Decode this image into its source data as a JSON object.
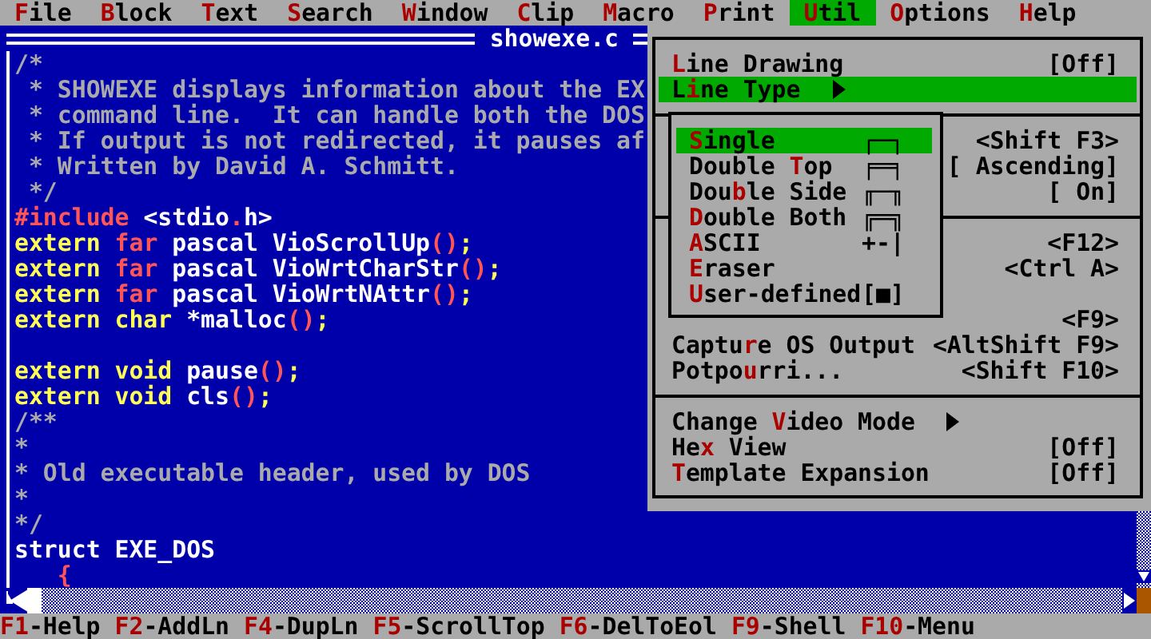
{
  "menu_bar": [
    {
      "label": "**F**ile",
      "selected": false
    },
    {
      "label": "**B**lock",
      "selected": false
    },
    {
      "label": "**T**ext",
      "selected": false
    },
    {
      "label": "**S**earch",
      "selected": false
    },
    {
      "label": "**W**indow",
      "selected": false
    },
    {
      "label": "**C**lip",
      "selected": false
    },
    {
      "label": "**M**acro",
      "selected": false
    },
    {
      "label": "**P**rint",
      "selected": false
    },
    {
      "label": "**U**til",
      "selected": true
    },
    {
      "label": "**O**ptions",
      "selected": false
    },
    {
      "label": "**H**elp",
      "selected": false
    }
  ],
  "editor": {
    "title": "showexe.c",
    "lines": [
      {
        "tokens": [
          {
            "text": "/*",
            "kind": "comment"
          }
        ]
      },
      {
        "tokens": [
          {
            "text": " * SHOWEXE displays information about the EX",
            "kind": "comment"
          }
        ]
      },
      {
        "tokens": [
          {
            "text": " * command line.  It can handle both the DOS",
            "kind": "comment"
          }
        ]
      },
      {
        "tokens": [
          {
            "text": " * If output is not redirected, it pauses af",
            "kind": "comment"
          }
        ]
      },
      {
        "tokens": [
          {
            "text": " * Written by David A. Schmitt.",
            "kind": "comment"
          }
        ]
      },
      {
        "tokens": [
          {
            "text": " */",
            "kind": "comment"
          }
        ]
      },
      {
        "tokens": [
          {
            "text": "#include",
            "kind": "accent"
          },
          {
            "text": " <stdio",
            "kind": "text"
          },
          {
            "text": ".",
            "kind": "accent"
          },
          {
            "text": "h>",
            "kind": "text"
          }
        ]
      },
      {
        "tokens": [
          {
            "text": "extern ",
            "kind": "keyword"
          },
          {
            "text": "far ",
            "kind": "accent"
          },
          {
            "text": "pascal VioScrollUp",
            "kind": "text"
          },
          {
            "text": "()",
            "kind": "accent"
          },
          {
            "text": ";",
            "kind": "keyword"
          }
        ]
      },
      {
        "tokens": [
          {
            "text": "extern ",
            "kind": "keyword"
          },
          {
            "text": "far ",
            "kind": "accent"
          },
          {
            "text": "pascal VioWrtCharStr",
            "kind": "text"
          },
          {
            "text": "()",
            "kind": "accent"
          },
          {
            "text": ";",
            "kind": "keyword"
          }
        ]
      },
      {
        "tokens": [
          {
            "text": "extern ",
            "kind": "keyword"
          },
          {
            "text": "far ",
            "kind": "accent"
          },
          {
            "text": "pascal VioWrtNAttr",
            "kind": "text"
          },
          {
            "text": "()",
            "kind": "accent"
          },
          {
            "text": ";",
            "kind": "keyword"
          }
        ]
      },
      {
        "tokens": [
          {
            "text": "extern char ",
            "kind": "keyword"
          },
          {
            "text": "*malloc",
            "kind": "text"
          },
          {
            "text": "()",
            "kind": "accent"
          },
          {
            "text": ";",
            "kind": "keyword"
          }
        ]
      },
      {
        "blank_line_before": true,
        "tokens": [
          {
            "text": "extern void ",
            "kind": "keyword"
          },
          {
            "text": "pause",
            "kind": "text"
          },
          {
            "text": "()",
            "kind": "accent"
          },
          {
            "text": ";",
            "kind": "keyword"
          }
        ]
      },
      {
        "tokens": [
          {
            "text": "extern void ",
            "kind": "keyword"
          },
          {
            "text": "cls",
            "kind": "text"
          },
          {
            "text": "()",
            "kind": "accent"
          },
          {
            "text": ";",
            "kind": "keyword"
          }
        ]
      },
      {
        "tokens": [
          {
            "text": "/**",
            "kind": "comment"
          }
        ]
      },
      {
        "tokens": [
          {
            "text": "*",
            "kind": "comment"
          }
        ]
      },
      {
        "tokens": [
          {
            "text": "* Old executable header, used by DOS",
            "kind": "comment"
          }
        ]
      },
      {
        "tokens": [
          {
            "text": "*",
            "kind": "comment"
          }
        ]
      },
      {
        "tokens": [
          {
            "text": "*/",
            "kind": "comment"
          }
        ]
      },
      {
        "tokens": [
          {
            "text": "struct EXE_DOS",
            "kind": "text"
          }
        ]
      },
      {
        "tokens": [
          {
            "text": "   {",
            "kind": "accent"
          }
        ]
      }
    ]
  },
  "util_menu": {
    "items": [
      {
        "kind": "item",
        "label": "**L**ine Drawing",
        "shortcut": "[Off]",
        "submenu": false,
        "selected": false
      },
      {
        "kind": "item",
        "label": "L**i**ne Type",
        "submenu": true,
        "selected": true
      },
      {
        "kind": "separator"
      },
      {
        "kind": "item",
        "shortcut": "<Shift F3>",
        "selected": false
      },
      {
        "kind": "item",
        "shortcut": "[ Ascending]",
        "selected": false
      },
      {
        "kind": "item",
        "shortcut": "[ On]",
        "selected": false
      },
      {
        "kind": "separator"
      },
      {
        "kind": "item",
        "shortcut": "<F12>",
        "selected": false
      },
      {
        "kind": "item",
        "shortcut": "<Ctrl A>",
        "selected": false
      },
      {
        "kind": "item",
        "selected": false
      },
      {
        "kind": "item",
        "shortcut": "<F9>",
        "submenu": false,
        "selected": false
      },
      {
        "kind": "item",
        "label": "Captu**r**e OS Output",
        "shortcut": "<AltShift F9>",
        "submenu": false,
        "selected": false
      },
      {
        "kind": "item",
        "label": "Potpo**u**rri...",
        "shortcut": "<Shift F10>",
        "submenu": false,
        "selected": false
      },
      {
        "kind": "separator"
      },
      {
        "kind": "item",
        "label": "Change **V**ideo Mode",
        "submenu": true,
        "selected": false
      },
      {
        "kind": "item",
        "label": "He**x** View",
        "shortcut": "[Off]",
        "submenu": false,
        "selected": false
      },
      {
        "kind": "item",
        "label": "**T**emplate Expansion",
        "shortcut": "[Off]",
        "submenu": false,
        "selected": false
      }
    ]
  },
  "line_type_menu": {
    "items": [
      {
        "label": "**S**ingle",
        "sample": "┌─┐",
        "selected": true
      },
      {
        "label": "Double **T**op",
        "sample": "╒═╕",
        "selected": false
      },
      {
        "label": "Dou**b**le Side",
        "sample": "╓─╖",
        "selected": false
      },
      {
        "label": "**D**ouble Both",
        "sample": "╔═╗",
        "selected": false
      },
      {
        "label": "**A**SCII",
        "sample": "+-|",
        "selected": false
      },
      {
        "label": "**E**raser",
        "selected": false
      },
      {
        "label": "**U**ser-defined",
        "sample": "[■]",
        "selected": false
      }
    ]
  },
  "function_keys": [
    {
      "key": "F1",
      "label": "-Help"
    },
    {
      "key": "F2",
      "label": "-AddLn"
    },
    {
      "key": "F4",
      "label": "-DupLn"
    },
    {
      "key": "F5",
      "label": "-ScrollTop"
    },
    {
      "key": "F6",
      "label": "-DelToEol"
    },
    {
      "key": "F9",
      "label": "-Shell"
    },
    {
      "key": "F10",
      "label": "-Menu"
    }
  ]
}
